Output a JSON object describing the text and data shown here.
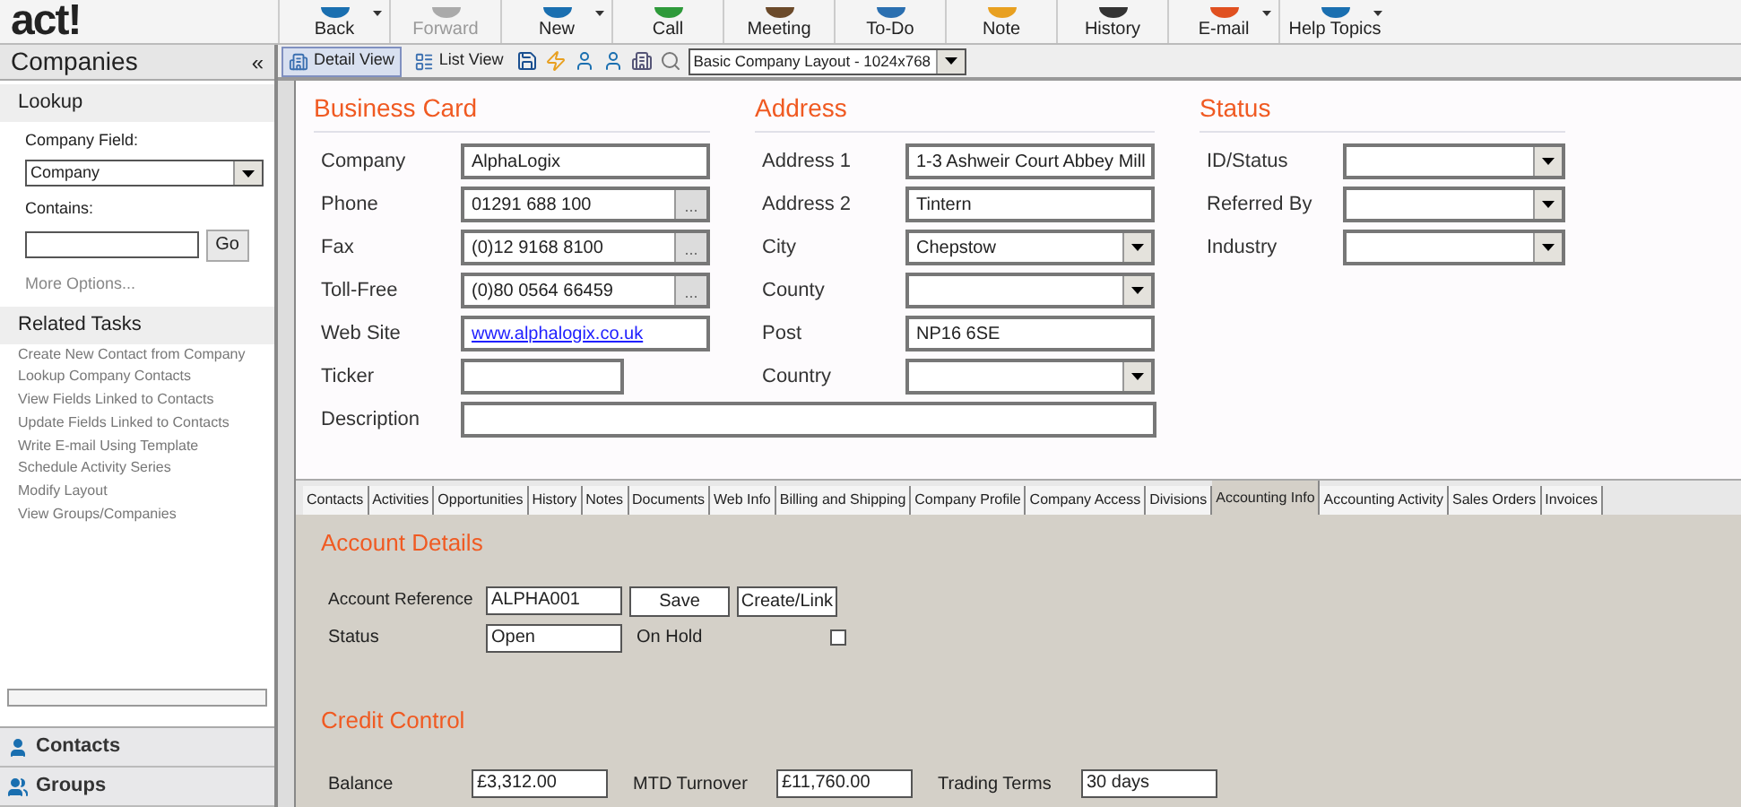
{
  "logo": "act!",
  "toolbar": [
    {
      "label": "Back",
      "disabled": false,
      "dropdown": true
    },
    {
      "label": "Forward",
      "disabled": true,
      "dropdown": false
    },
    {
      "label": "New",
      "disabled": false,
      "dropdown": true
    },
    {
      "label": "Call",
      "disabled": false,
      "dropdown": false
    },
    {
      "label": "Meeting",
      "disabled": false,
      "dropdown": false
    },
    {
      "label": "To-Do",
      "disabled": false,
      "dropdown": false
    },
    {
      "label": "Note",
      "disabled": false,
      "dropdown": false
    },
    {
      "label": "History",
      "disabled": false,
      "dropdown": false
    },
    {
      "label": "E-mail",
      "disabled": false,
      "dropdown": true
    },
    {
      "label": "Help Topics",
      "disabled": false,
      "dropdown": true
    }
  ],
  "sidebar": {
    "title": "Companies",
    "collapse": "«",
    "lookup": {
      "heading": "Lookup",
      "field_label": "Company Field:",
      "field_value": "Company",
      "contains_label": "Contains:",
      "go": "Go",
      "more": "More Options..."
    },
    "related_tasks": {
      "heading": "Related Tasks",
      "items": [
        "Create New Contact from Company",
        "Lookup Company Contacts",
        "View Fields Linked to Contacts",
        "Update Fields Linked to Contacts",
        "Write E-mail Using Template",
        "Schedule Activity Series",
        "Modify Layout",
        "View Groups/Companies"
      ]
    },
    "nav": [
      "Contacts",
      "Groups"
    ]
  },
  "view_tabs": [
    {
      "label": "Detail View",
      "selected": true
    },
    {
      "label": "List View",
      "selected": false
    }
  ],
  "layout_select": "Basic Company Layout - 1024x768",
  "business_card": {
    "title": "Business Card",
    "fields": [
      {
        "label": "Company",
        "value": "AlphaLogix",
        "kind": "text"
      },
      {
        "label": "Phone",
        "value": "01291 688 100",
        "kind": "phone",
        "more": "..."
      },
      {
        "label": "Fax",
        "value": "(0)12 9168 8100",
        "kind": "phone",
        "more": "..."
      },
      {
        "label": "Toll-Free",
        "value": "(0)80 0564 66459",
        "kind": "phone",
        "more": "..."
      },
      {
        "label": "Web Site",
        "value": "www.alphalogix.co.uk",
        "kind": "link"
      },
      {
        "label": "Ticker",
        "kind": "short"
      }
    ],
    "description": {
      "label": "Description"
    }
  },
  "address": {
    "title": "Address",
    "fields": [
      {
        "label": "Address 1",
        "value": "1-3 Ashweir Court Abbey Mill",
        "kind": "text"
      },
      {
        "label": "Address 2",
        "value": "Tintern",
        "kind": "text"
      },
      {
        "label": "City",
        "value": "Chepstow",
        "kind": "select"
      },
      {
        "label": "County",
        "kind": "select"
      },
      {
        "label": "Post",
        "value": "NP16 6SE",
        "kind": "text"
      },
      {
        "label": "Country",
        "kind": "select"
      }
    ]
  },
  "status": {
    "title": "Status",
    "fields": [
      {
        "label": "ID/Status",
        "kind": "select"
      },
      {
        "label": "Referred By",
        "kind": "select"
      },
      {
        "label": "Industry",
        "kind": "select"
      }
    ]
  },
  "tabs": [
    {
      "label": "Contacts",
      "selected": false
    },
    {
      "label": "Activities",
      "selected": false
    },
    {
      "label": "Opportunities",
      "selected": false
    },
    {
      "label": "History",
      "selected": false
    },
    {
      "label": "Notes",
      "selected": false
    },
    {
      "label": "Documents",
      "selected": false
    },
    {
      "label": "Web Info",
      "selected": false
    },
    {
      "label": "Billing and Shipping",
      "selected": false
    },
    {
      "label": "Company Profile",
      "selected": false
    },
    {
      "label": "Company Access",
      "selected": false
    },
    {
      "label": "Divisions",
      "selected": false
    },
    {
      "label": "Accounting Info",
      "selected": true
    },
    {
      "label": "Accounting Activity",
      "selected": false
    },
    {
      "label": "Sales Orders",
      "selected": false
    },
    {
      "label": "Invoices",
      "selected": false
    }
  ],
  "account_details": {
    "title": "Account Details",
    "reference": {
      "label": "Account Reference",
      "value": "ALPHA001"
    },
    "save": "Save",
    "create": "Create/Link",
    "status": {
      "label": "Status",
      "value": "Open"
    },
    "on_hold": {
      "label": "On Hold",
      "checked": false
    }
  },
  "credit_control": {
    "title": "Credit Control",
    "fields": [
      {
        "label": "Balance",
        "value": "£3,312.00"
      },
      {
        "label": "MTD Turnover",
        "value": "£11,760.00"
      },
      {
        "label": "Trading Terms",
        "value": "30 days"
      }
    ]
  }
}
